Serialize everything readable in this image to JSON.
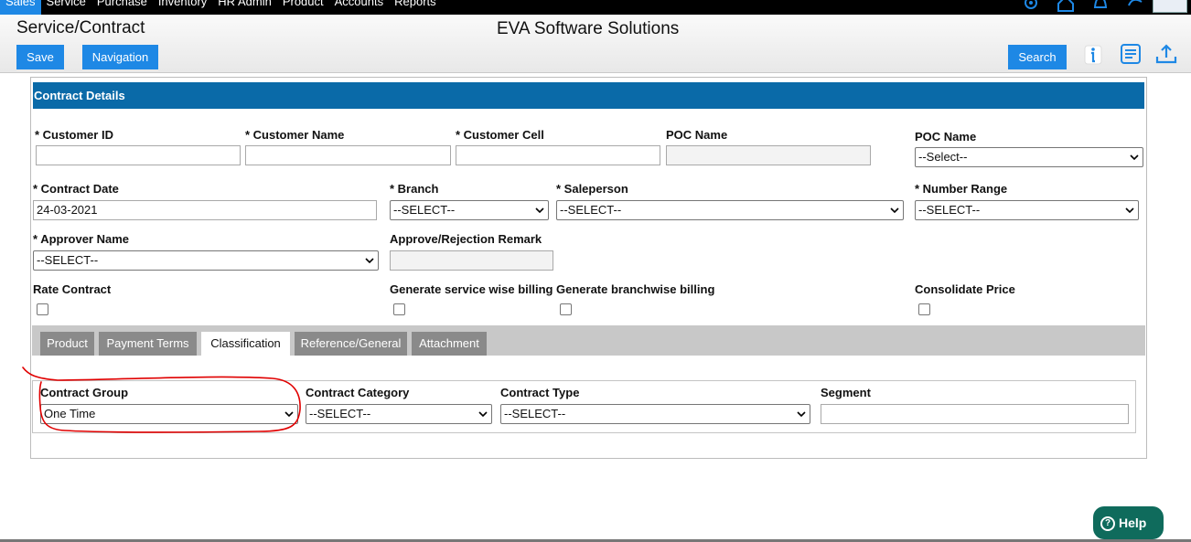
{
  "menu": [
    "Sales",
    "Service",
    "Purchase",
    "Inventory",
    "HR Admin",
    "Product",
    "Accounts",
    "Reports"
  ],
  "header": {
    "title": "Service/Contract",
    "company": "EVA Software Solutions",
    "save_label": "Save",
    "navigation_label": "Navigation",
    "search_label": "Search"
  },
  "contract": {
    "section_title": "Contract Details",
    "customer_id_label": "* Customer ID",
    "customer_name_label": "* Customer Name",
    "customer_cell_label": "* Customer Cell",
    "poc_name_label": "POC Name",
    "poc_name_select_label": "POC Name",
    "poc_name_select_value": "--Select--",
    "contract_date_label": "* Contract Date",
    "contract_date_value": "24-03-2021",
    "branch_label": "* Branch",
    "branch_value": "--SELECT--",
    "saleperson_label": "* Saleperson",
    "saleperson_value": "--SELECT--",
    "number_range_label": "* Number Range",
    "number_range_value": "--SELECT--",
    "approver_label": "* Approver Name",
    "approver_value": "--SELECT--",
    "remark_label": "Approve/Rejection Remark",
    "rate_contract_label": "Rate Contract",
    "service_billing_label": "Generate service wise billing",
    "branch_billing_label": "Generate branchwise billing",
    "consolidate_label": "Consolidate Price"
  },
  "tabs": [
    "Product",
    "Payment Terms",
    "Classification",
    "Reference/General",
    "Attachment"
  ],
  "classification": {
    "group_label": "Contract Group",
    "group_value": "One Time",
    "category_label": "Contract Category",
    "category_value": "--SELECT--",
    "type_label": "Contract Type",
    "type_value": "--SELECT--",
    "segment_label": "Segment"
  },
  "help_label": "Help",
  "colors": {
    "accent": "#1e88e5",
    "section_header": "#0a6aa8",
    "help": "#0f6b5c",
    "annotation": "#e00000"
  }
}
